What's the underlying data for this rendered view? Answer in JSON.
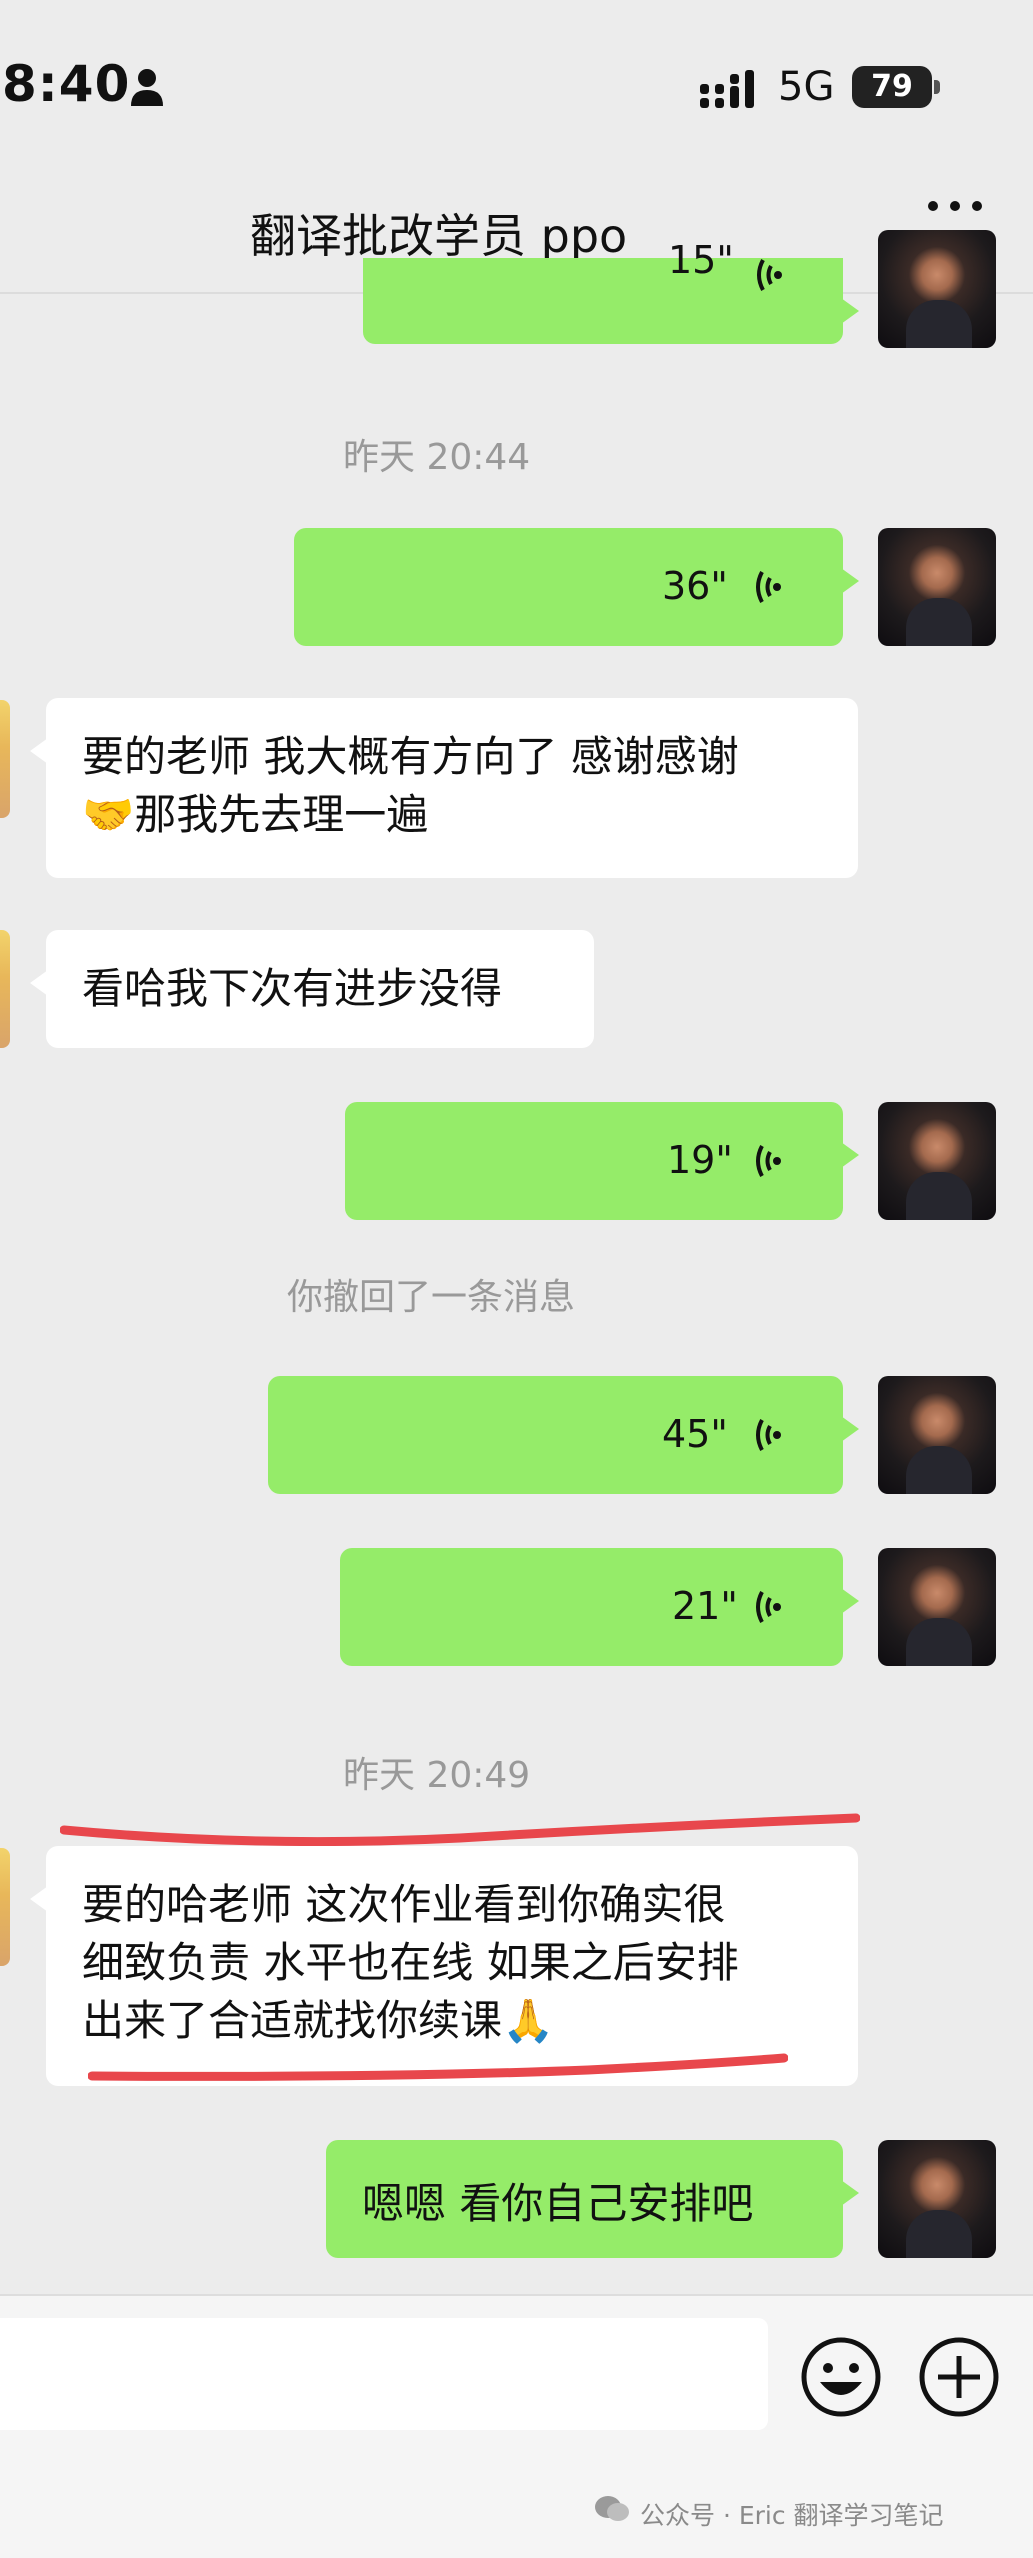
{
  "status_bar": {
    "time": "8:40",
    "network": "5G",
    "battery": "79"
  },
  "header": {
    "title": "翻译批改学员 ppo"
  },
  "messages": {
    "voice_top": {
      "duration": "15\""
    },
    "ts1": "昨天 20:44",
    "voice1": {
      "duration": "36\""
    },
    "text1_line1": "要的老师 我大概有方向了 感谢感谢",
    "text1_line2": "🤝那我先去理一遍",
    "text2": "看哈我下次有进步没得",
    "voice2": {
      "duration": "19\""
    },
    "recall": "你撤回了一条消息",
    "voice3": {
      "duration": "45\""
    },
    "voice4": {
      "duration": "21\""
    },
    "ts2": "昨天 20:49",
    "text3_line1": "要的哈老师 这次作业看到你确实很",
    "text3_line2": "细致负责 水平也在线 如果之后安排",
    "text3_line3": "出来了合适就找你续课🙏",
    "text4": "嗯嗯 看你自己安排吧"
  },
  "watermark": "公众号 · Eric 翻译学习笔记",
  "colors": {
    "self_bubble": "#95ec69",
    "other_bubble": "#ffffff",
    "background": "#ececec",
    "annotation": "#e8474c"
  }
}
